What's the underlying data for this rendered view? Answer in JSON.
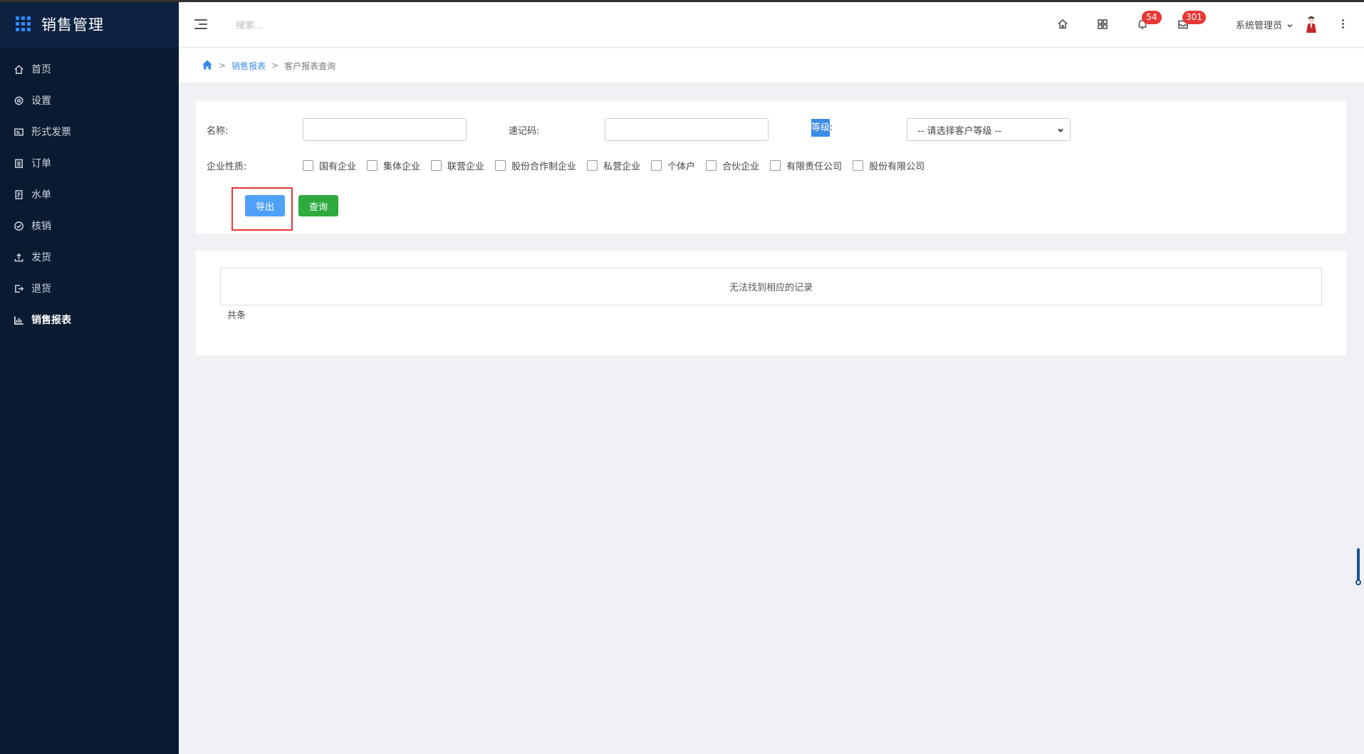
{
  "brand": {
    "title": "销售管理"
  },
  "sidebar": {
    "items": [
      {
        "label": "首页",
        "icon": "home-icon"
      },
      {
        "label": "设置",
        "icon": "gear-icon"
      },
      {
        "label": "形式发票",
        "icon": "invoice-icon"
      },
      {
        "label": "订单",
        "icon": "clipboard-icon"
      },
      {
        "label": "水单",
        "icon": "receipt-icon"
      },
      {
        "label": "核销",
        "icon": "check-circle-icon"
      },
      {
        "label": "发货",
        "icon": "upload-icon"
      },
      {
        "label": "退货",
        "icon": "return-icon"
      },
      {
        "label": "销售报表",
        "icon": "bar-chart-icon",
        "active": true
      }
    ]
  },
  "header": {
    "search_placeholder": "搜索...",
    "notifications_count": "54",
    "messages_count": "301",
    "user_name": "系统管理员"
  },
  "breadcrumb": {
    "sep": ">",
    "level1": "销售报表",
    "level2": "客户报表查询"
  },
  "filter": {
    "name_label": "名称:",
    "code_label": "速记码:",
    "level_label_highlight": "等级",
    "level_label_colon": ":",
    "level_select": "-- 请选择客户等级 --",
    "nature_label": "企业性质:",
    "natures": [
      "国有企业",
      "集体企业",
      "联营企业",
      "股份合作制企业",
      "私营企业",
      "个体户",
      "合伙企业",
      "有限责任公司",
      "股份有限公司"
    ],
    "export_label": "导出",
    "query_label": "查询"
  },
  "results": {
    "empty_text": "无法找到相应的记录",
    "total_text": "共条"
  },
  "colors": {
    "sidebar_bg": "#0a1a30",
    "accent_blue": "#3b8be8",
    "export_blue": "#4ea1f7",
    "query_green": "#2eaa3f",
    "badge_red": "#e53935"
  }
}
